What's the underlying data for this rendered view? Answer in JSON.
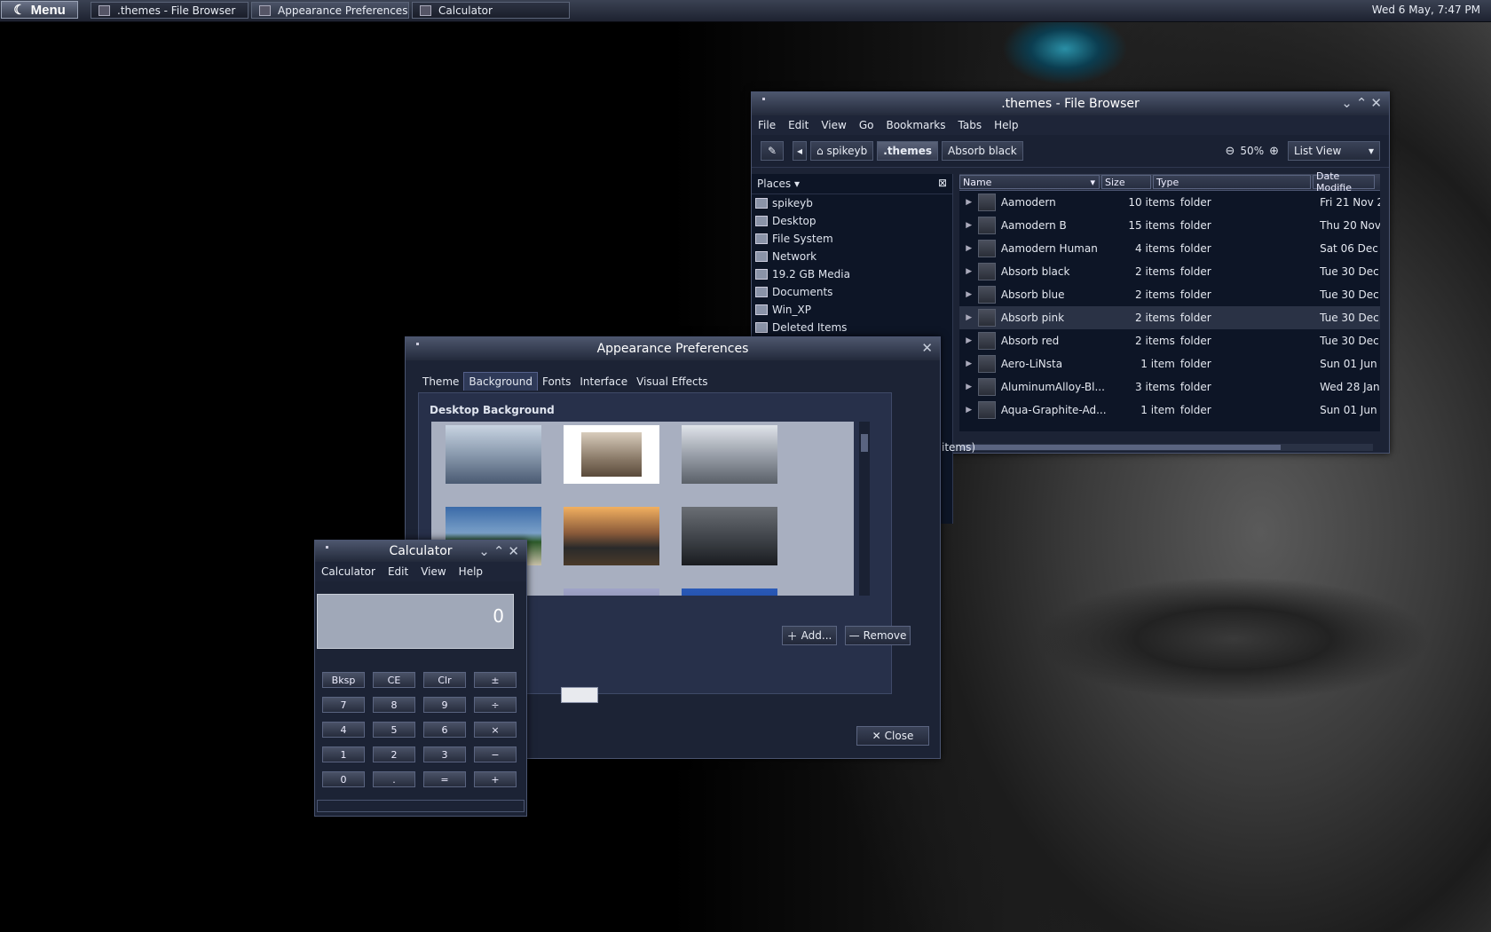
{
  "panel": {
    "menu_label": "Menu",
    "tasks": [
      ".themes - File Browser",
      "Appearance Preferences",
      "Calculator"
    ],
    "clock": "Wed  6 May,  7:47 PM"
  },
  "filebrowser": {
    "title": ".themes - File Browser",
    "menu": [
      "File",
      "Edit",
      "View",
      "Go",
      "Bookmarks",
      "Tabs",
      "Help"
    ],
    "path": [
      "spikeyb",
      ".themes",
      "Absorb black"
    ],
    "zoom": "50%",
    "view_mode": "List View",
    "places_label": "Places",
    "places": [
      "spikeyb",
      "Desktop",
      "File System",
      "Network",
      "19.2 GB Media",
      "Documents",
      "Win_XP",
      "Deleted Items"
    ],
    "columns": [
      "Name",
      "Size",
      "Type",
      "Date Modifie"
    ],
    "rows": [
      {
        "name": "Aamodern",
        "size": "10 items",
        "type": "folder",
        "date": "Fri 21 Nov 2"
      },
      {
        "name": "Aamodern B",
        "size": "15 items",
        "type": "folder",
        "date": "Thu 20 Nov"
      },
      {
        "name": "Aamodern Human",
        "size": "4 items",
        "type": "folder",
        "date": "Sat 06 Dec"
      },
      {
        "name": "Absorb black",
        "size": "2 items",
        "type": "folder",
        "date": "Tue 30 Dec"
      },
      {
        "name": "Absorb blue",
        "size": "2 items",
        "type": "folder",
        "date": "Tue 30 Dec"
      },
      {
        "name": "Absorb pink",
        "size": "2 items",
        "type": "folder",
        "date": "Tue 30 Dec"
      },
      {
        "name": "Absorb red",
        "size": "2 items",
        "type": "folder",
        "date": "Tue 30 Dec"
      },
      {
        "name": "Aero-LiNsta",
        "size": "1 item",
        "type": "folder",
        "date": "Sun 01 Jun"
      },
      {
        "name": "AluminumAlloy-Bl...",
        "size": "3 items",
        "type": "folder",
        "date": "Wed 28 Jan"
      },
      {
        "name": "Aqua-Graphite-Ad...",
        "size": "1 item",
        "type": "folder",
        "date": "Sun 01 Jun"
      }
    ],
    "status": "items)"
  },
  "appearance": {
    "title": "Appearance Preferences",
    "tabs": [
      "Theme",
      "Background",
      "Fonts",
      "Interface",
      "Visual Effects"
    ],
    "section": "Desktop Background",
    "add_label": "Add...",
    "remove_label": "Remove",
    "close_label": "Close"
  },
  "calculator": {
    "title": "Calculator",
    "menu": [
      "Calculator",
      "Edit",
      "View",
      "Help"
    ],
    "display": "0",
    "keys": [
      "Bksp",
      "CE",
      "Clr",
      "±",
      "7",
      "8",
      "9",
      "÷",
      "4",
      "5",
      "6",
      "×",
      "1",
      "2",
      "3",
      "−",
      "0",
      ".",
      "=",
      "+"
    ]
  }
}
